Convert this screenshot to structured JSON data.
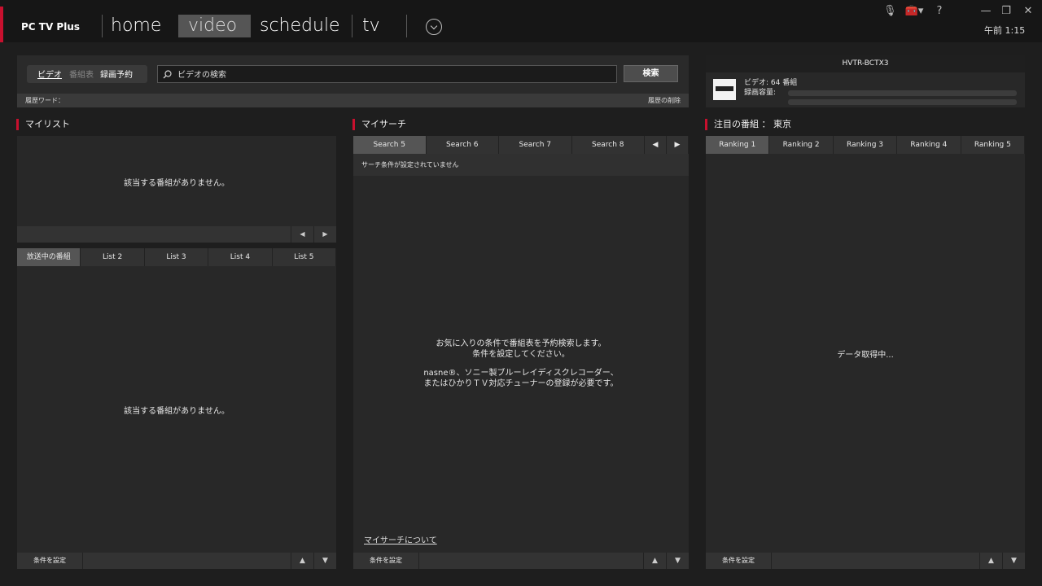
{
  "app": {
    "brand": "PC TV Plus",
    "clock": "午前 1:15"
  },
  "nav": {
    "home": "home",
    "video": "video",
    "schedule": "schedule",
    "tv": "tv"
  },
  "window_icons": {
    "mic_off": "🎙",
    "toolbox": "🧰▾",
    "help": "?",
    "minimize": "—",
    "restore": "❐",
    "close": "✕"
  },
  "search": {
    "seg_video": "ビデオ",
    "seg_epg": "番組表",
    "seg_reserve": "録画予約",
    "placeholder": "ビデオの検索",
    "button": "検索",
    "history_label": "履歴ワード：",
    "history_clear": "履歴の削除"
  },
  "device": {
    "name": "HVTR-BCTX3",
    "video_count": "ビデオ: 64 番組",
    "capacity_label": "録画容量:"
  },
  "mylist": {
    "title": "マイリスト",
    "empty_top": "該当する番組がありません。",
    "tabs": [
      "放送中の番組",
      "List 2",
      "List 3",
      "List 4",
      "List 5"
    ],
    "empty_bottom": "該当する番組がありません。",
    "footer_button": "条件を設定"
  },
  "mysearch": {
    "title": "マイサーチ",
    "tabs": [
      "Search 5",
      "Search 6",
      "Search 7",
      "Search 8"
    ],
    "notice": "サーチ条件が設定されていません",
    "msg1": "お気に入りの条件で番組表を予約検索します。",
    "msg2": "条件を設定してください。",
    "msg3": "nasne®、ソニー製ブルーレイディスクレコーダー、",
    "msg4": "またはひかりＴＶ対応チューナーの登録が必要です。",
    "link": "マイサーチについて",
    "footer_button": "条件を設定"
  },
  "ranking": {
    "title": "注目の番組 ： 東京",
    "tabs": [
      "Ranking 1",
      "Ranking 2",
      "Ranking 3",
      "Ranking 4",
      "Ranking 5"
    ],
    "loading": "データ取得中...",
    "footer_button": "条件を設定"
  },
  "icons": {
    "prev": "◀",
    "next": "▶",
    "up": "▲",
    "down": "▼",
    "search": "search-icon"
  },
  "colors": {
    "accent_red": "#c8102e",
    "background": "#1e1e1e",
    "panel": "#282828"
  }
}
